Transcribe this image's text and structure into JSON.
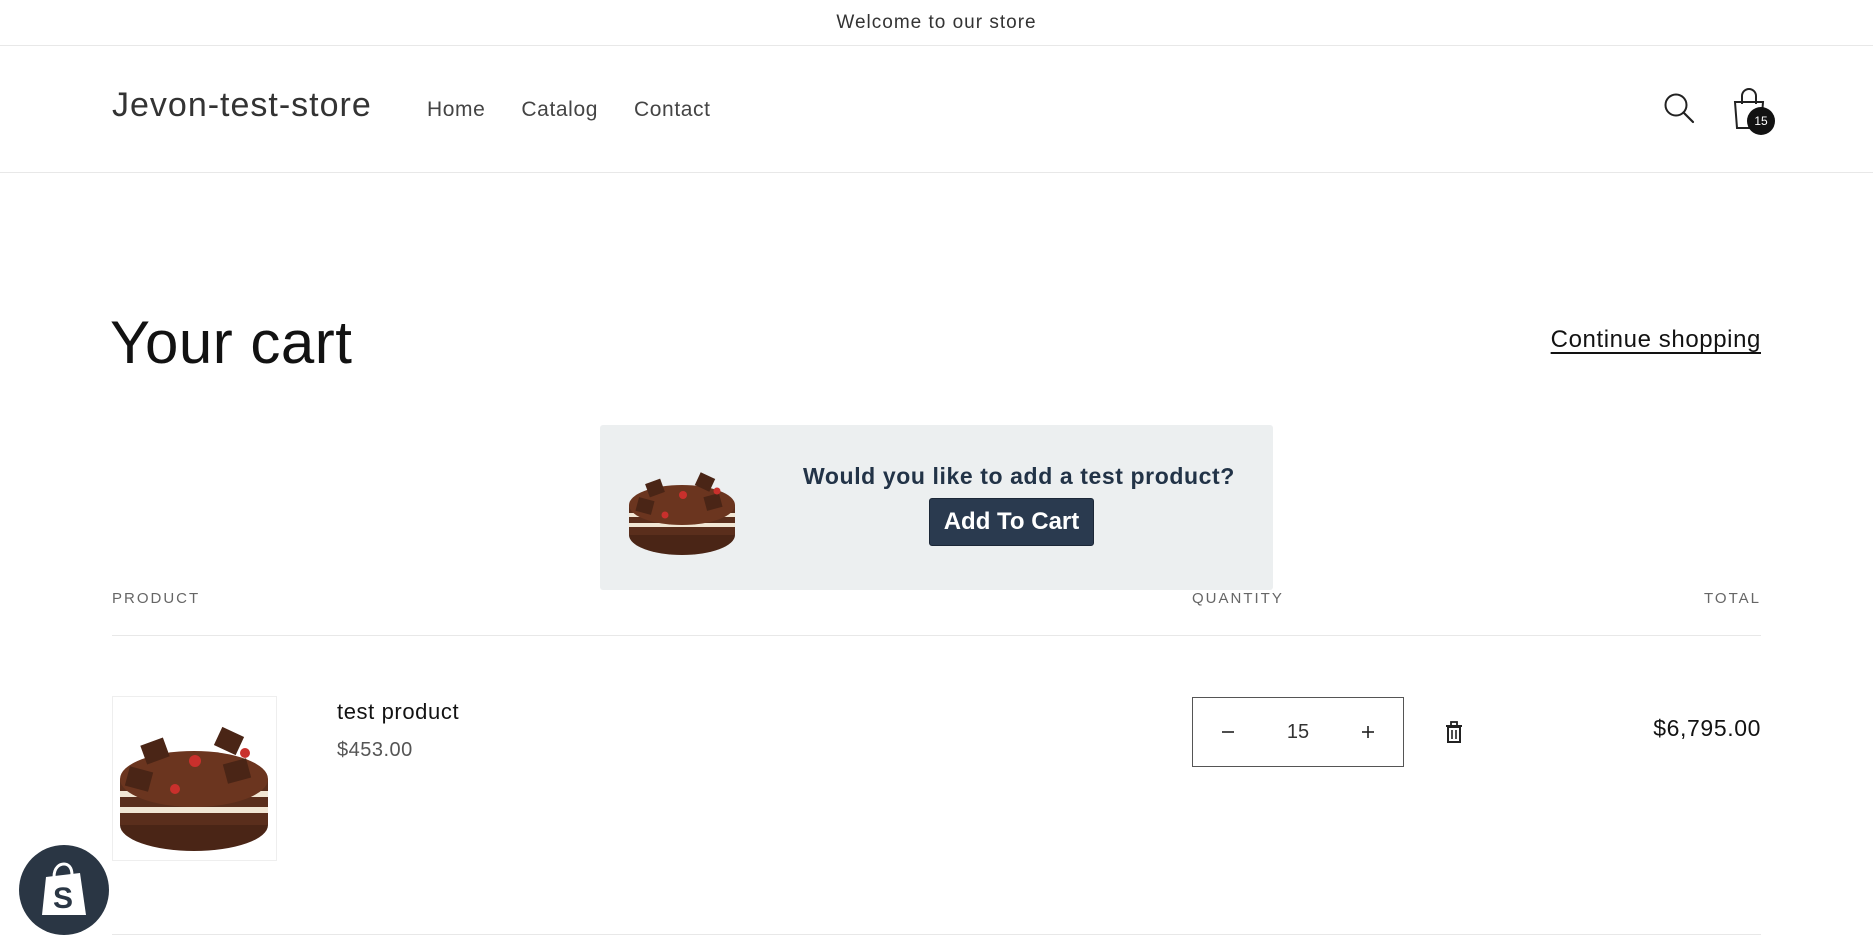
{
  "announcement": {
    "text": "Welcome to our store"
  },
  "header": {
    "store_name": "Jevon-test-store",
    "nav": [
      {
        "label": "Home"
      },
      {
        "label": "Catalog"
      },
      {
        "label": "Contact"
      }
    ],
    "search_icon": "search-icon",
    "cart_icon": "shopping-bag-icon",
    "cart_count": "15"
  },
  "cart": {
    "title": "Your cart",
    "continue_label": "Continue shopping",
    "columns": {
      "product": "PRODUCT",
      "quantity": "QUANTITY",
      "total": "TOTAL"
    },
    "items": [
      {
        "name": "test product",
        "price": "$453.00",
        "quantity": "15",
        "total": "$6,795.00"
      }
    ]
  },
  "upsell": {
    "question": "Would you like to add a test product?",
    "button_label": "Add To Cart"
  },
  "colors": {
    "upsell_background": "#eceff0",
    "upsell_button": "#2a3a4f",
    "badge_background": "#2a3644"
  }
}
